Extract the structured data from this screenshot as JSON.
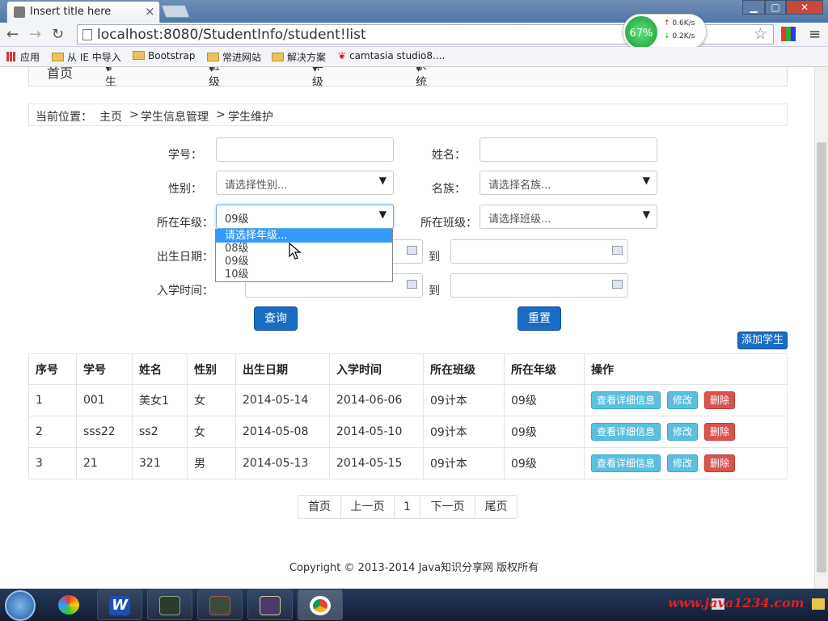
{
  "browser": {
    "tab_title": "Insert title here",
    "tab_close": "×",
    "url": "localhost:8080/StudentInfo/student!list",
    "speed": {
      "percent": "67%",
      "up": "0.6K/s",
      "down": "0.2K/s"
    },
    "bookmarks": [
      "应用",
      "从 IE 中导入",
      "Bootstrap",
      "常进网站",
      "解决方案",
      "camtasia studio8...."
    ]
  },
  "nav": {
    "items": [
      "首页",
      "学生信息管理",
      "班级信息管理",
      "年级信息管理",
      "系统管理"
    ]
  },
  "breadcrumb": {
    "prefix": "当前位置：",
    "home": "主页",
    "sep": ">",
    "section": "学生信息管理",
    "page": "学生维护"
  },
  "form": {
    "student_no_label": "学号：",
    "name_label": "姓名：",
    "gender_label": "性别：",
    "gender_value": "请选择性别...",
    "ethnic_label": "名族：",
    "ethnic_value": "请选择名族...",
    "grade_label": "所在年级：",
    "grade_value": "09级",
    "grade_options": [
      "请选择年级...",
      "08级",
      "09级",
      "10级"
    ],
    "class_label": "所在班级：",
    "class_value": "请选择班级...",
    "birth_label": "出生日期：",
    "enroll_label": "入学时间：",
    "to_label": "到",
    "query_btn": "查询",
    "reset_btn": "重置"
  },
  "add_btn": "添加学生",
  "table": {
    "headers": [
      "序号",
      "学号",
      "姓名",
      "性别",
      "出生日期",
      "入学时间",
      "所在班级",
      "所在年级",
      "操作"
    ],
    "rows": [
      [
        "1",
        "001",
        "美女1",
        "女",
        "2014-05-14",
        "2014-06-06",
        "09计本",
        "09级"
      ],
      [
        "2",
        "sss22",
        "ss2",
        "女",
        "2014-05-08",
        "2014-05-10",
        "09计本",
        "09级"
      ],
      [
        "3",
        "21",
        "321",
        "男",
        "2014-05-13",
        "2014-05-15",
        "09计本",
        "09级"
      ]
    ],
    "op_detail": "查看详细信息",
    "op_edit": "修改",
    "op_delete": "删除"
  },
  "pager": [
    "首页",
    "上一页",
    "1",
    "下一页",
    "尾页"
  ],
  "footer": "Copyright © 2013-2014 Java知识分享网 版权所有",
  "watermark": "www.java1234.com",
  "colors": {
    "primary": "#1a6cc4",
    "info": "#5bc0de",
    "danger": "#d9534f",
    "highlight": "#3399ff"
  }
}
